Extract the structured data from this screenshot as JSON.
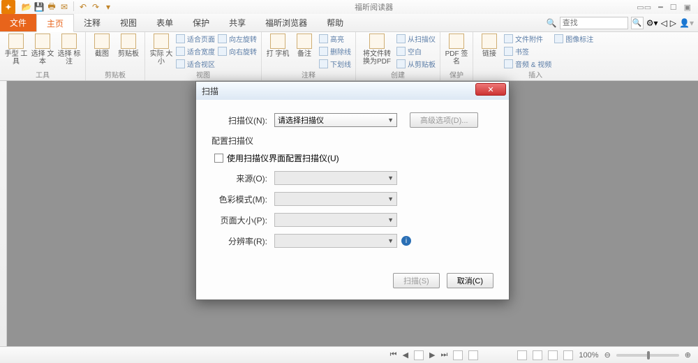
{
  "titlebar": {
    "app_title": "福昕阅读器"
  },
  "tabs": {
    "file": "文件",
    "home": "主页",
    "comment": "注释",
    "view": "视图",
    "form": "表单",
    "protect": "保护",
    "share": "共享",
    "browser": "福昕浏览器",
    "help": "帮助"
  },
  "search": {
    "placeholder": "查找"
  },
  "ribbon": {
    "tools": {
      "label": "工具",
      "hand": "手型\n工具",
      "seltext": "选择\n文本",
      "selannot": "选择\n标注"
    },
    "clipboard": {
      "label": "剪贴板",
      "snapshot": "截图",
      "clip": "剪贴板"
    },
    "viewg": {
      "label": "视图",
      "actual": "实际\n大小",
      "fitpage": "适合页面",
      "fitwidth": "适合宽度",
      "fitview": "适合视区",
      "rotl": "向左旋转",
      "rotr": "向右旋转"
    },
    "commentg": {
      "label": "注释",
      "typewriter": "打\n字机",
      "note": "备注",
      "hl": "高亮",
      "st": "删除线",
      "ul": "下划线"
    },
    "createg": {
      "label": "创建",
      "convert": "将文件转\n换为PDF",
      "fromscan": "从扫描仪",
      "blank": "空白",
      "fromclip": "从剪贴板"
    },
    "protectg": {
      "label": "保护",
      "sign": "PDF\n签名"
    },
    "insertg": {
      "label": "插入",
      "link": "链接",
      "attach": "文件附件",
      "bookmark": "书签",
      "imgannot": "图像标注",
      "av": "音频 & 视频"
    }
  },
  "dialog": {
    "title": "扫描",
    "scanner_label": "扫描仪(N):",
    "scanner_placeholder": "请选择扫描仪",
    "advanced": "高级选项(D)...",
    "config_title": "配置扫描仪",
    "use_native": "使用扫描仪界面配置扫描仪(U)",
    "source": "来源(O):",
    "colormode": "色彩模式(M):",
    "pagesize": "页面大小(P):",
    "resolution": "分辨率(R):",
    "scan_btn": "扫描(S)",
    "cancel_btn": "取消(C)"
  },
  "status": {
    "zoom": "100%"
  }
}
